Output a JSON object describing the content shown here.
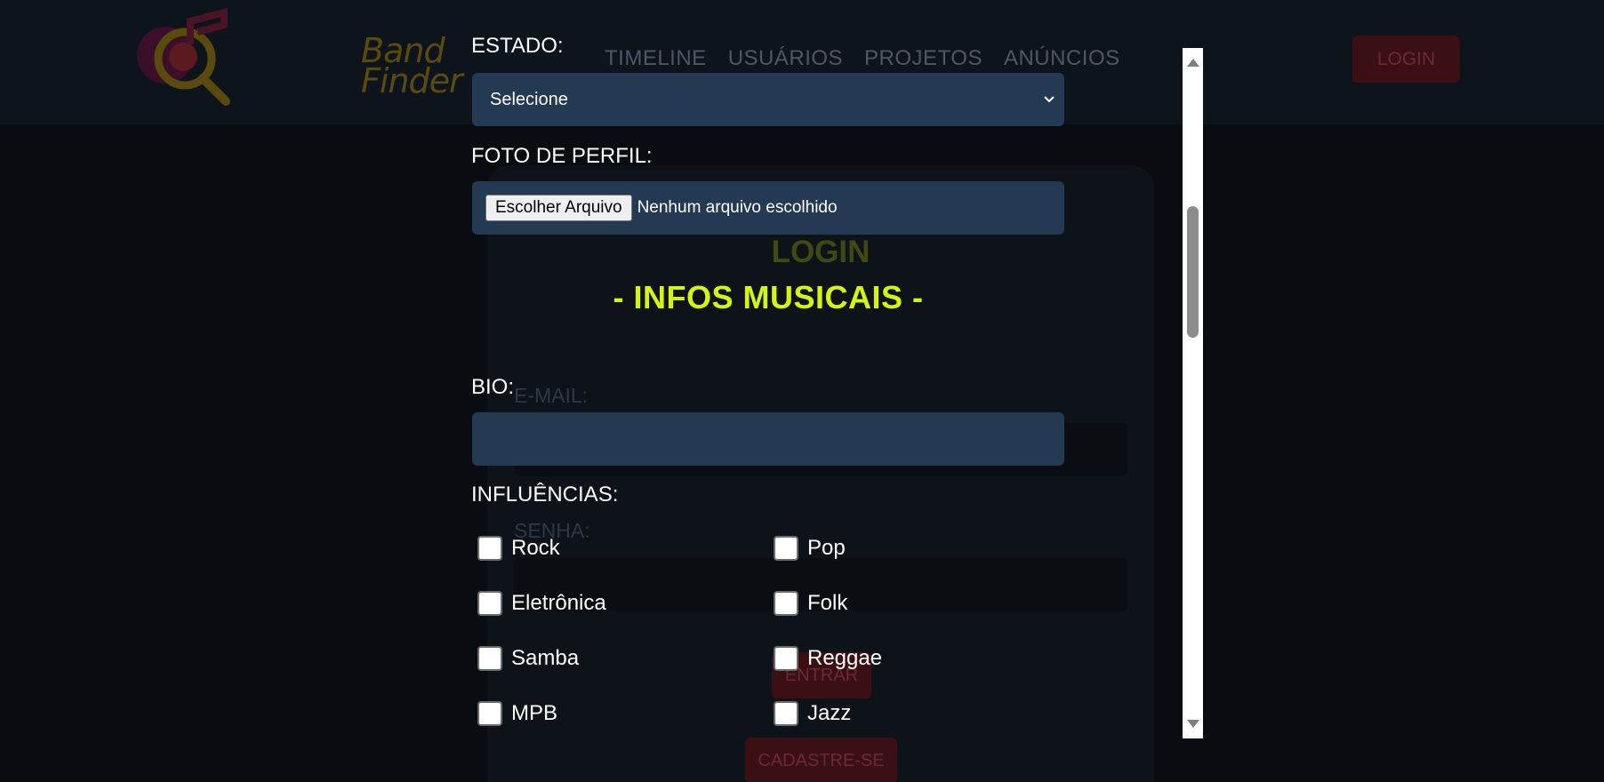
{
  "header": {
    "logo_text_line1": "Band",
    "logo_text_line2": "Finder",
    "nav": [
      "TIMELINE",
      "USUÁRIOS",
      "PROJETOS",
      "ANÚNCIOS"
    ],
    "login_button": "LOGIN"
  },
  "login_card": {
    "title": "LOGIN",
    "email_label": "E-MAIL:",
    "password_label": "SENHA:",
    "enter_button": "ENTRAR",
    "signup_button": "CADASTRE-SE"
  },
  "form": {
    "state_label": "ESTADO:",
    "state_select_value": "Selecione",
    "photo_label": "FOTO DE PERFIL:",
    "file_button": "Escolher Arquivo",
    "file_status": "Nenhum arquivo escolhido",
    "section_title": "- INFOS MUSICAIS -",
    "bio_label": "BIO:",
    "influences_label": "INFLUÊNCIAS:",
    "influences": [
      {
        "label": "Rock",
        "checked": false
      },
      {
        "label": "Pop",
        "checked": false
      },
      {
        "label": "Eletrônica",
        "checked": false
      },
      {
        "label": "Folk",
        "checked": false
      },
      {
        "label": "Samba",
        "checked": false
      },
      {
        "label": "Reggae",
        "checked": false
      },
      {
        "label": "MPB",
        "checked": false
      },
      {
        "label": "Jazz",
        "checked": false
      }
    ]
  },
  "colors": {
    "accent": "#d4f511",
    "field_bg": "#233a52",
    "button_red": "#3a1015"
  }
}
